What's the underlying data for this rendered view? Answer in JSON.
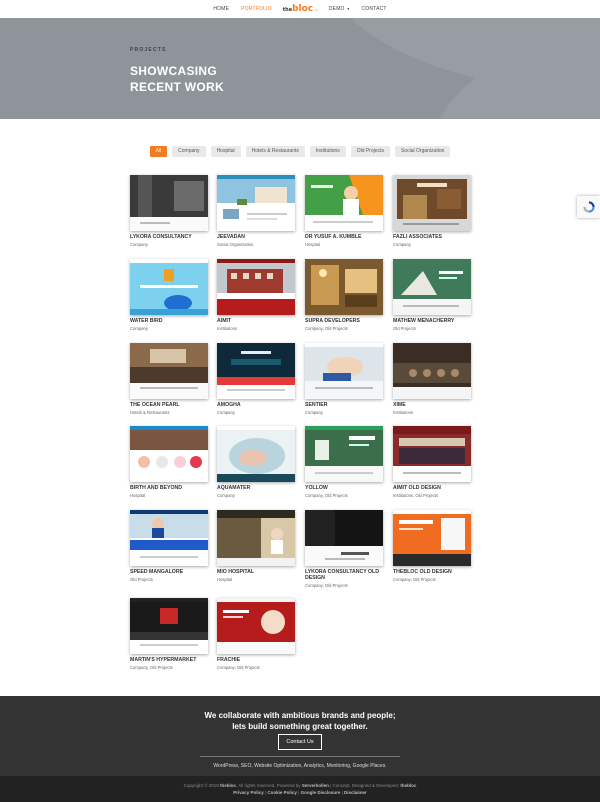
{
  "nav": {
    "items": [
      "HOME",
      "PORTFOLIO"
    ],
    "logo": {
      "the": "the",
      "bloc": "bloc",
      "suffix": ".in"
    },
    "items_right": [
      "DEMO",
      "CONTACT"
    ]
  },
  "hero": {
    "eyebrow": "PROJECTS",
    "title_line1": "SHOWCASING",
    "title_line2": "RECENT WORK"
  },
  "filters": [
    "All",
    "Company",
    "Hospital",
    "Hotels & Restaurants",
    "Institutions",
    "Old Projects",
    "Social Organization"
  ],
  "projects": [
    {
      "name": "LYKORA CONSULTANCY",
      "category": "Company"
    },
    {
      "name": "JEEVADAN",
      "category": "Social Organization"
    },
    {
      "name": "DR YUSUF A. KUMBLE",
      "category": "Hospital"
    },
    {
      "name": "FAZLI ASSOCIATES",
      "category": "Company"
    },
    {
      "name": "WATER BIRD",
      "category": "Company"
    },
    {
      "name": "AIMIT",
      "category": "Institutions"
    },
    {
      "name": "SUPRA DEVELOPERS",
      "category": "Company, Old Projects"
    },
    {
      "name": "MATHEW MENACHERRY",
      "category": "Old Projects"
    },
    {
      "name": "THE OCEAN PEARL",
      "category": "Hotels & Restaurants"
    },
    {
      "name": "AMOGHA",
      "category": "Company"
    },
    {
      "name": "SENTIER",
      "category": "Company"
    },
    {
      "name": "XIME",
      "category": "Institutions"
    },
    {
      "name": "BIRTH AND BEYOND",
      "category": "Hospital"
    },
    {
      "name": "AQUAMATER",
      "category": "Company"
    },
    {
      "name": "YOLLOW",
      "category": "Company, Old Projects"
    },
    {
      "name": "AIMIT OLD DESIGN",
      "category": "Institutions, Old Projects"
    },
    {
      "name": "SPEED MANGALORE",
      "category": "Old Projects"
    },
    {
      "name": "MIO HOSPITAL",
      "category": "Hospital"
    },
    {
      "name": "LYKORA CONSULTANCY OLD DESIGN",
      "category": "Company, Old Projects"
    },
    {
      "name": "THEBLOC OLD DESIGN",
      "category": "Company, Old Projects"
    },
    {
      "name": "MARTIN'S HYPERMARKET",
      "category": "Company, Old Projects"
    },
    {
      "name": "FRACHIE",
      "category": "Company, Old Projects"
    }
  ],
  "footer": {
    "pitch_line1": "We collaborate with ambitious brands and people;",
    "pitch_line2": "lets build something great together.",
    "contact_label": "Contact Us",
    "services": "WordPress, SEO, Website Optimization, Analytics, Monitoring, Google Places.",
    "copyright_prefix": "Copyright © 2019",
    "brand": "thebloc",
    "rights": ". All rights reserved. Powered by",
    "powered_by": "Serverkollen",
    "concept_text": "| Concept, Designed & Developed:",
    "developer": "thebloc",
    "links": [
      "Privacy Policy",
      "Cookie Policy",
      "Google Disclosure",
      "Disclaimer"
    ]
  },
  "colors": {
    "accent": "#f47b20",
    "hero_bg": "#8e949a",
    "footer_bg": "#333333",
    "bottom_bg": "#222222"
  }
}
